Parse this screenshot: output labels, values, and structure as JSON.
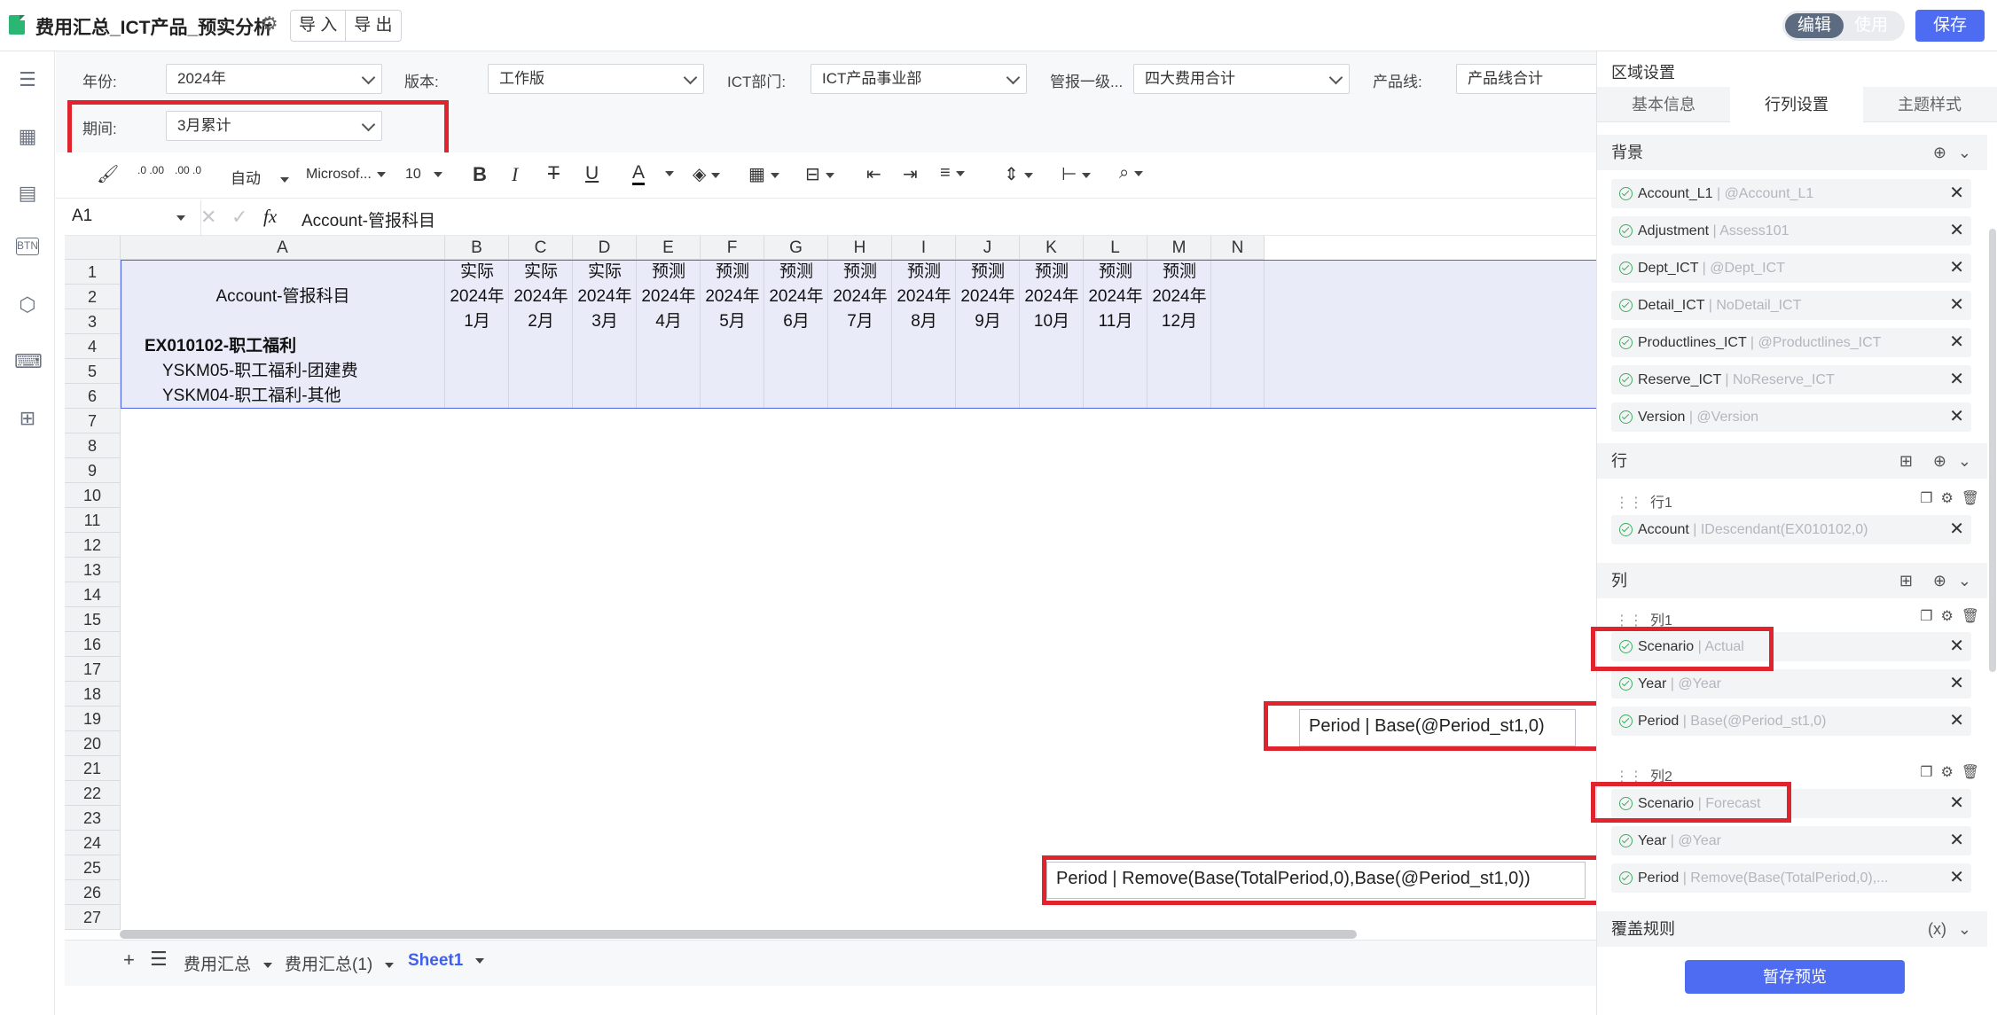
{
  "header": {
    "title": "费用汇总_ICT产品_预实分析",
    "import_label": "导 入",
    "export_label": "导 出",
    "mode_edit": "编辑",
    "mode_use": "使用",
    "save_label": "保存"
  },
  "filters": {
    "year_label": "年份:",
    "year_value": "2024年",
    "version_label": "版本:",
    "version_value": "工作版",
    "dept_label": "ICT部门:",
    "dept_value": "ICT产品事业部",
    "mgmt_label": "管报一级...",
    "mgmt_value": "四大费用合计",
    "pline_label": "产品线:",
    "pline_value": "产品线合计",
    "period_label": "期间:",
    "period_value": "3月累计"
  },
  "toolbar": {
    "auto_label": "自动",
    "font_name": "Microsof...",
    "font_size": "10",
    "decimal_add": ".0 .00",
    "decimal_remove": ".00 .0"
  },
  "formula_bar": {
    "cell_ref": "A1",
    "fx": "fx",
    "content": "Account-管报科目"
  },
  "grid": {
    "columns": [
      "A",
      "B",
      "C",
      "D",
      "E",
      "F",
      "G",
      "H",
      "I",
      "J",
      "K",
      "L",
      "M",
      "N"
    ],
    "rows": [
      "1",
      "2",
      "3",
      "4",
      "5",
      "6",
      "7",
      "8",
      "9",
      "10",
      "11",
      "12",
      "13",
      "14",
      "15",
      "16",
      "17",
      "18",
      "19",
      "20",
      "21",
      "22",
      "23",
      "24",
      "25",
      "26",
      "27"
    ],
    "header_label": "Account-管报科目",
    "month_cols": [
      {
        "scenario": "实际",
        "year": "2024年",
        "month": "1月"
      },
      {
        "scenario": "实际",
        "year": "2024年",
        "month": "2月"
      },
      {
        "scenario": "实际",
        "year": "2024年",
        "month": "3月"
      },
      {
        "scenario": "预测",
        "year": "2024年",
        "month": "4月"
      },
      {
        "scenario": "预测",
        "year": "2024年",
        "month": "5月"
      },
      {
        "scenario": "预测",
        "year": "2024年",
        "month": "6月"
      },
      {
        "scenario": "预测",
        "year": "2024年",
        "month": "7月"
      },
      {
        "scenario": "预测",
        "year": "2024年",
        "month": "8月"
      },
      {
        "scenario": "预测",
        "year": "2024年",
        "month": "9月"
      },
      {
        "scenario": "预测",
        "year": "2024年",
        "month": "10月"
      },
      {
        "scenario": "预测",
        "year": "2024年",
        "month": "11月"
      },
      {
        "scenario": "预测",
        "year": "2024年",
        "month": "12月"
      }
    ],
    "row4": "EX010102-职工福利",
    "row5": "YSKM05-职工福利-团建费",
    "row6": "YSKM04-职工福利-其他"
  },
  "sheets": [
    "费用汇总",
    "费用汇总(1)",
    "Sheet1"
  ],
  "tooltips": {
    "period1": "Period | Base(@Period_st1,0)",
    "period2": "Period | Remove(Base(TotalPeriod,0),Base(@Period_st1,0))"
  },
  "panel": {
    "title": "区域设置",
    "tabs": [
      "基本信息",
      "行列设置",
      "主题样式"
    ],
    "background_title": "背景",
    "background_items": [
      {
        "name": "Account_L1",
        "value": "@Account_L1"
      },
      {
        "name": "Adjustment",
        "value": "Assess101"
      },
      {
        "name": "Dept_ICT",
        "value": "@Dept_ICT"
      },
      {
        "name": "Detail_ICT",
        "value": "NoDetail_ICT"
      },
      {
        "name": "Productlines_ICT",
        "value": "@Productlines_ICT"
      },
      {
        "name": "Reserve_ICT",
        "value": "NoReserve_ICT"
      },
      {
        "name": "Version",
        "value": "@Version"
      }
    ],
    "rows_title": "行",
    "row_group": "行1",
    "row_item": {
      "name": "Account",
      "value": "IDescendant(EX010102,0)"
    },
    "cols_title": "列",
    "col1_group": "列1",
    "col1_items": [
      {
        "name": "Scenario",
        "value": "Actual"
      },
      {
        "name": "Year",
        "value": "@Year"
      },
      {
        "name": "Period",
        "value": "Base(@Period_st1,0)"
      }
    ],
    "col2_group": "列2",
    "col2_items": [
      {
        "name": "Scenario",
        "value": "Forecast"
      },
      {
        "name": "Year",
        "value": "@Year"
      },
      {
        "name": "Period",
        "value": "Remove(Base(TotalPeriod,0),..."
      }
    ],
    "override_title": "覆盖规则",
    "preview_label": "暂存预览",
    "separator": " | "
  }
}
